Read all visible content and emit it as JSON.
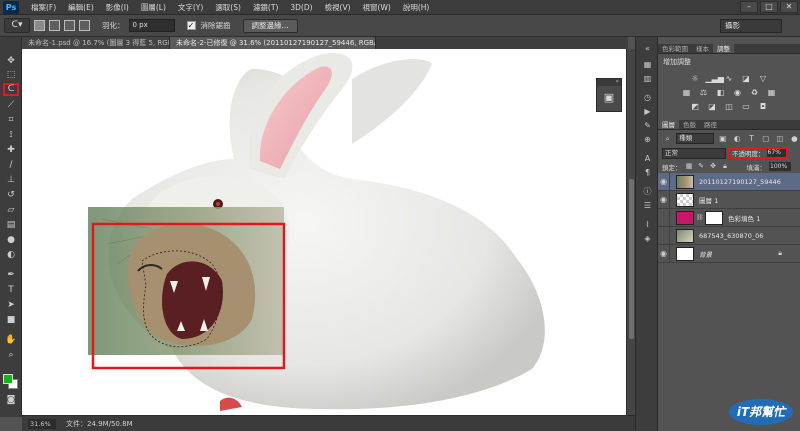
{
  "app": {
    "logo_text": "Ps"
  },
  "menu": {
    "items": [
      "檔案(F)",
      "編輯(E)",
      "影像(I)",
      "圖層(L)",
      "文字(Y)",
      "選取(S)",
      "濾鏡(T)",
      "3D(D)",
      "檢視(V)",
      "視窗(W)",
      "說明(H)"
    ]
  },
  "window_controls": {
    "minimize": "–",
    "maximize": "□",
    "close": "✕"
  },
  "options_bar": {
    "tool_icon": "lasso-icon",
    "feather_label": "羽化：",
    "feather_value": "0 px",
    "antialias_label": "消除鋸齒",
    "antialias_checked": true,
    "refine_edge_button": "調整邊緣...",
    "workspace_value": "攝影"
  },
  "document_tabs": [
    {
      "label": "未命名-1.psd @ 16.7% (圖層 3 得藍 5, RGB/8) *",
      "active": false
    },
    {
      "label": "未命名-2-已修復 @ 31.6% (20110127190127_59446, RGB/8) *",
      "active": true
    }
  ],
  "status_bar": {
    "zoom": "31.6%",
    "doc_info": "文件：24.9M/50.8M"
  },
  "adjustments_panel": {
    "tabs": [
      "色彩範圍",
      "樣本",
      "調整"
    ],
    "active_tab": 2,
    "title": "增加調整"
  },
  "layers_panel": {
    "tabs": [
      "圖層",
      "色版",
      "路徑"
    ],
    "active_tab": 0,
    "kind_label": "種類",
    "blend_mode": "正常",
    "opacity_label": "不透明度：",
    "opacity_value": "67%",
    "lock_label": "鎖定：",
    "fill_label": "填滿：",
    "fill_value": "100%",
    "layers": [
      {
        "name": "20110127190127_59446",
        "visible": true,
        "selected": true,
        "thumb": "lynx"
      },
      {
        "name": "圖層 1",
        "visible": true,
        "selected": false,
        "thumb": "checker"
      },
      {
        "name": "色彩填色 1",
        "visible": false,
        "selected": false,
        "thumb": "magenta",
        "mask": true
      },
      {
        "name": "687543_630870_06",
        "visible": false,
        "selected": false,
        "thumb": "photo"
      },
      {
        "name": "背景",
        "visible": true,
        "selected": false,
        "thumb": "white",
        "italic": true,
        "locked": true
      }
    ]
  },
  "watermark": {
    "text": "iT邦幫忙"
  },
  "colors": {
    "foreground": "#17b31c",
    "background": "#ffffff",
    "highlight_red": "#e0191c",
    "fill_layer": "#c8176a"
  }
}
